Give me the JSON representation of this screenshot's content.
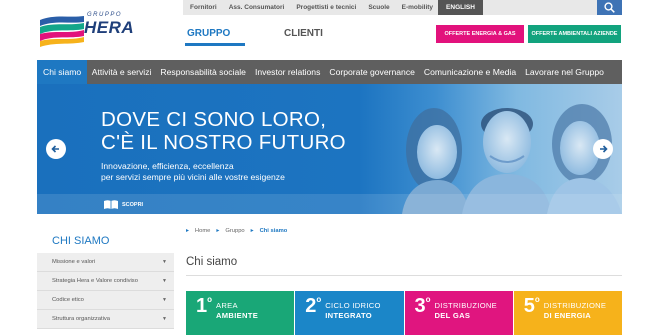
{
  "logo": {
    "group": "GRUPPO",
    "name": "HERA"
  },
  "topbar": {
    "links": [
      "Fornitori",
      "Ass. Consumatori",
      "Progettisti e tecnici",
      "Scuole",
      "E-mobility"
    ],
    "language": "ENGLISH",
    "search_icon": "search-icon"
  },
  "header": {
    "tab_gruppo": "GRUPPO",
    "tab_clienti": "CLIENTI",
    "offer_energy": "OFFERTE ENERGIA & GAS",
    "offer_env": "OFFERTE AMBIENTALI AZIENDE"
  },
  "colors": {
    "brand_blue": "#1e78c2",
    "magenta": "#e2127c",
    "green": "#12a37e",
    "nav_grey": "#5f5f5f"
  },
  "nav": {
    "items": [
      "Chi siamo",
      "Attività e servizi",
      "Responsabilità sociale",
      "Investor relations",
      "Corporate governance",
      "Comunicazione e Media",
      "Lavorare nel Gruppo"
    ]
  },
  "hero": {
    "title_line1": "DOVE CI SONO LORO,",
    "title_line2": "C'È IL NOSTRO FUTURO",
    "subtitle_line1": "Innovazione, efficienza, eccellenza",
    "subtitle_line2": "per servizi sempre più vicini alle vostre esigenze",
    "cta": "SCOPRI"
  },
  "sidebar": {
    "title": "CHI SIAMO",
    "items": [
      {
        "label": "Missione e valori"
      },
      {
        "label": "Strategia Hera e Valore condiviso"
      },
      {
        "label": "Codice etico"
      },
      {
        "label": "Struttura organizzativa"
      }
    ]
  },
  "breadcrumb": {
    "home": "Home",
    "gruppo": "Gruppo",
    "current": "Chi siamo"
  },
  "main": {
    "title": "Chi siamo"
  },
  "tiles": [
    {
      "num": "1",
      "sup": "o",
      "line1": "AREA",
      "line2": "AMBIENTE",
      "color": "#19a777"
    },
    {
      "num": "2",
      "sup": "o",
      "line1": "CICLO IDRICO",
      "line2": "INTEGRATO",
      "color": "#1b86c8"
    },
    {
      "num": "3",
      "sup": "o",
      "line1": "DISTRIBUZIONE",
      "line2": "DEL GAS",
      "color": "#e0157f"
    },
    {
      "num": "5",
      "sup": "o",
      "line1": "DISTRIBUZIONE",
      "line2": "DI ENERGIA",
      "color": "#f6b21b"
    }
  ]
}
